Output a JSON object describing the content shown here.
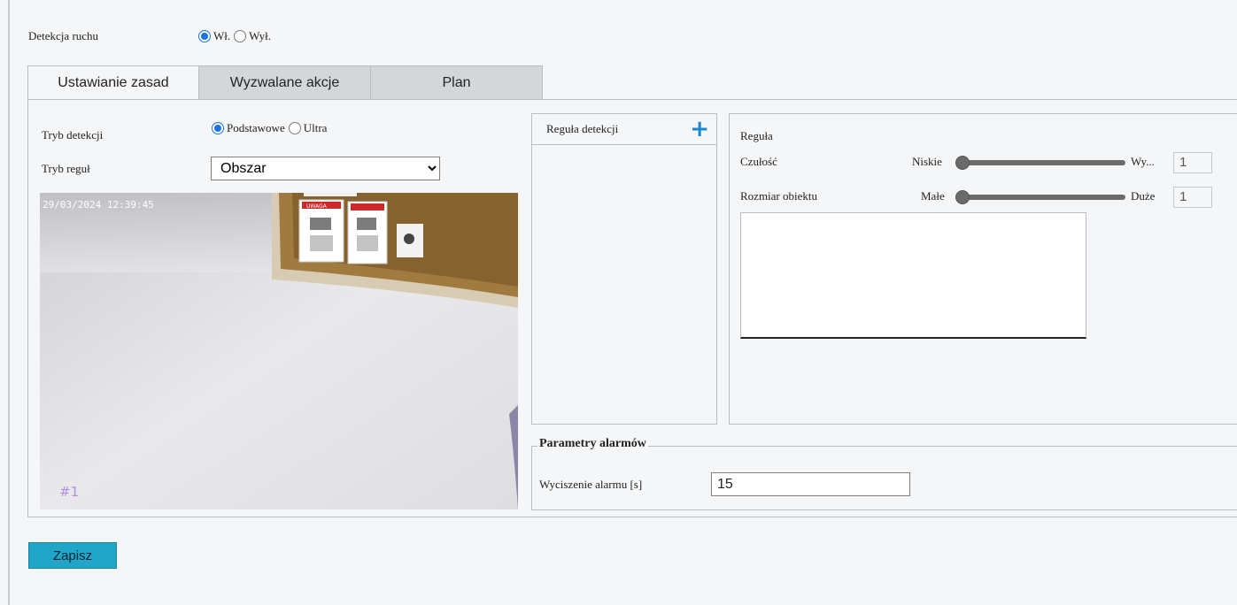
{
  "motion_detection": {
    "label": "Detekcja ruchu",
    "options": [
      "Wł.",
      "Wył."
    ],
    "selected": "Wł."
  },
  "tabs": [
    {
      "label": "Ustawianie zasad",
      "active": true
    },
    {
      "label": "Wyzwalane akcje",
      "active": false
    },
    {
      "label": "Plan",
      "active": false
    }
  ],
  "detection_mode": {
    "label": "Tryb detekcji",
    "options": [
      "Podstawowe",
      "Ultra"
    ],
    "selected": "Podstawowe"
  },
  "rule_mode": {
    "label": "Tryb reguł",
    "value": "Obszar"
  },
  "video": {
    "timestamp": "29/03/2024 12:39:45",
    "channel": "#1",
    "sign_text": "UWAGA"
  },
  "rules_list": {
    "header": "Reguła detekcji",
    "add_icon": "plus-icon"
  },
  "rule": {
    "title": "Reguła",
    "sensitivity": {
      "label": "Czułość",
      "min_label": "Niskie",
      "max_label": "Wy...",
      "value": "1"
    },
    "object_size": {
      "label": "Rozmiar obiektu",
      "min_label": "Małe",
      "max_label": "Duże",
      "value": "1"
    }
  },
  "alarm_params": {
    "legend": "Parametry alarmów",
    "silence_label": "Wyciszenie alarmu [s]",
    "silence_value": "15"
  },
  "save_label": "Zapisz",
  "colors": {
    "accent": "#1a73e8",
    "save_button": "#1fa6c9",
    "add_icon": "#1a86d0"
  }
}
